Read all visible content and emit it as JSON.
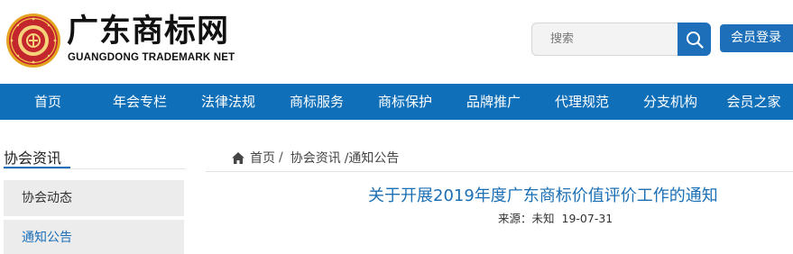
{
  "header": {
    "site_title": "广东商标网",
    "site_subtitle": "GUANGDONG TRADEMARK NET",
    "emblem_icon": "association-seal-icon",
    "search_placeholder": "搜索",
    "search_icon": "search-icon",
    "login_label": "会员登录"
  },
  "colors": {
    "brand_blue": "#0f6fb8",
    "title_blue": "#1a6fb5",
    "emblem_red": "#c4262e",
    "emblem_gold": "#e3a520"
  },
  "nav": {
    "items": [
      {
        "label": "首页"
      },
      {
        "label": "年会专栏"
      },
      {
        "label": "法律法规"
      },
      {
        "label": "商标服务"
      },
      {
        "label": "商标保护"
      },
      {
        "label": "品牌推广"
      },
      {
        "label": "代理规范"
      },
      {
        "label": "分支机构"
      },
      {
        "label": "会员之家"
      }
    ]
  },
  "sidebar": {
    "heading": "协会资讯",
    "items": [
      {
        "label": "协会动态"
      },
      {
        "label": "通知公告"
      }
    ]
  },
  "breadcrumb": {
    "icon": "home-icon",
    "home": "首页",
    "sep1": "/",
    "section": "协会资讯",
    "current": "/通知公告"
  },
  "article": {
    "title": "关于开展2019年度广东商标价值评价工作的通知",
    "source_label": "来源：",
    "source_value": "未知",
    "date": "19-07-31"
  }
}
